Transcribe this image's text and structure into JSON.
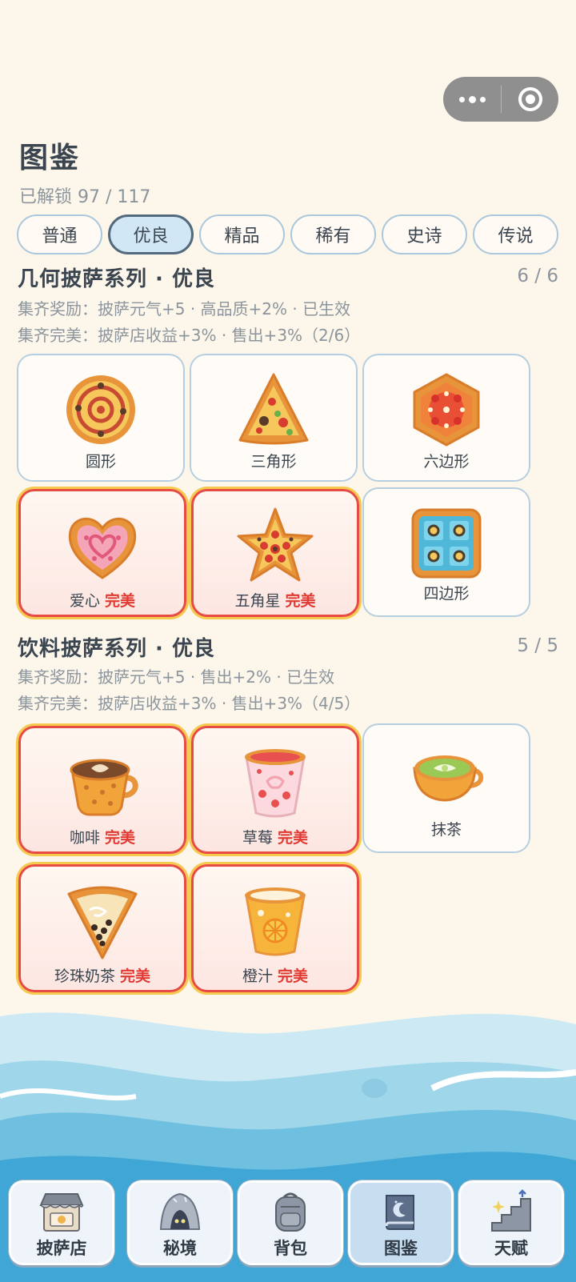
{
  "header": {
    "title": "图鉴",
    "unlock_text": "已解锁 97 / 117"
  },
  "tabs": [
    "普通",
    "优良",
    "精品",
    "稀有",
    "史诗",
    "传说"
  ],
  "active_tab": "优良",
  "perfect_label": "完美",
  "sections": [
    {
      "title": "几何披萨系列 · 优良",
      "count": "6 / 6",
      "reward_line": "集齐奖励：披萨元气+5 · 高品质+2% · 已生效",
      "perfect_line": "集齐完美：披萨店收益+3% · 售出+3%（2/6）",
      "items": [
        {
          "name": "圆形",
          "perfect": false,
          "icon": "round-pizza-icon"
        },
        {
          "name": "三角形",
          "perfect": false,
          "icon": "triangle-pizza-icon"
        },
        {
          "name": "六边形",
          "perfect": false,
          "icon": "hexagon-pizza-icon"
        },
        {
          "name": "爱心",
          "perfect": true,
          "icon": "heart-pizza-icon"
        },
        {
          "name": "五角星",
          "perfect": true,
          "icon": "star-pizza-icon"
        },
        {
          "name": "四边形",
          "perfect": false,
          "icon": "square-pizza-icon"
        }
      ]
    },
    {
      "title": "饮料披萨系列 · 优良",
      "count": "5 / 5",
      "reward_line": "集齐奖励：披萨元气+5 · 售出+2% · 已生效",
      "perfect_line": "集齐完美：披萨店收益+3% · 售出+3%（4/5）",
      "items": [
        {
          "name": "咖啡",
          "perfect": true,
          "icon": "coffee-pizza-icon"
        },
        {
          "name": "草莓",
          "perfect": true,
          "icon": "strawberry-pizza-icon"
        },
        {
          "name": "抹茶",
          "perfect": false,
          "icon": "matcha-pizza-icon"
        },
        {
          "name": "珍珠奶茶",
          "perfect": true,
          "icon": "bubble-tea-pizza-icon"
        },
        {
          "name": "橙汁",
          "perfect": true,
          "icon": "orange-juice-pizza-icon"
        }
      ]
    }
  ],
  "nav": [
    {
      "label": "披萨店",
      "icon": "shop-icon",
      "active": false
    },
    {
      "label": "秘境",
      "icon": "cave-icon",
      "active": false
    },
    {
      "label": "背包",
      "icon": "backpack-icon",
      "active": false
    },
    {
      "label": "图鉴",
      "icon": "book-icon",
      "active": true
    },
    {
      "label": "天赋",
      "icon": "stairs-icon",
      "active": false
    }
  ],
  "colors": {
    "perfect_text": "#e03a33",
    "active_tab_bg": "#d2e7f6",
    "page_bg": "#fdf6ea"
  }
}
